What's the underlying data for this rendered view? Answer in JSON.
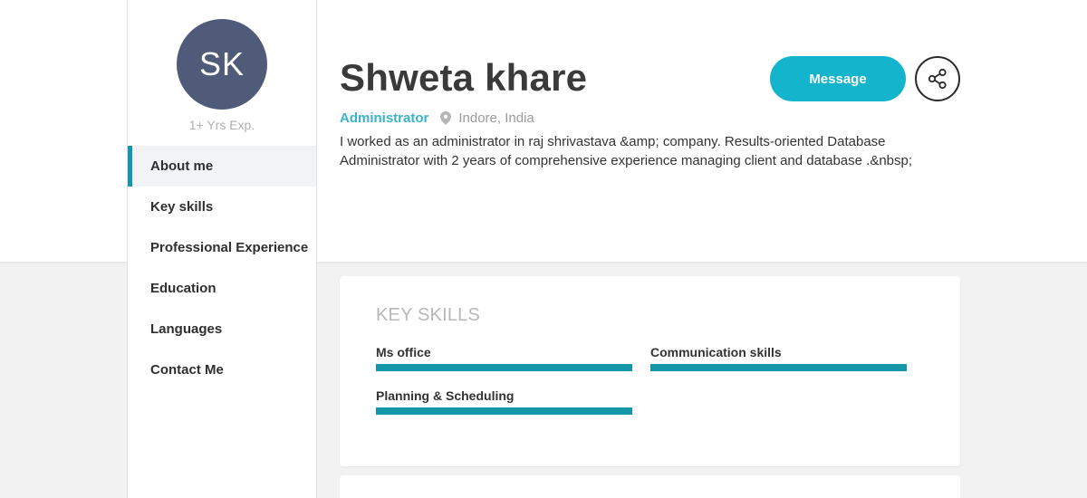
{
  "profile": {
    "initials": "SK",
    "experience": "1+ Yrs Exp.",
    "name": "Shweta khare",
    "role": "Administrator",
    "location": "Indore, India",
    "bio": "I worked as an administrator in raj shrivastava &amp; company. Results-oriented Database Administrator with 2 years of comprehensive experience managing client and database .&nbsp;"
  },
  "actions": {
    "message_label": "Message",
    "share_icon": "share-icon"
  },
  "nav": {
    "items": [
      {
        "label": "About me",
        "active": true
      },
      {
        "label": "Key skills",
        "active": false
      },
      {
        "label": "Professional Experience",
        "active": false
      },
      {
        "label": "Education",
        "active": false
      },
      {
        "label": "Languages",
        "active": false
      },
      {
        "label": "Contact Me",
        "active": false
      }
    ]
  },
  "key_skills": {
    "title": "KEY SKILLS",
    "skills": [
      {
        "label": "Ms office",
        "level": 1.0
      },
      {
        "label": "Communication skills",
        "level": 1.0
      },
      {
        "label": "Planning & Scheduling",
        "level": 1.0
      }
    ]
  },
  "colors": {
    "accent": "#1497a8",
    "button": "#14b4cc",
    "avatar": "#4f5b78",
    "role": "#3bb3c6"
  }
}
